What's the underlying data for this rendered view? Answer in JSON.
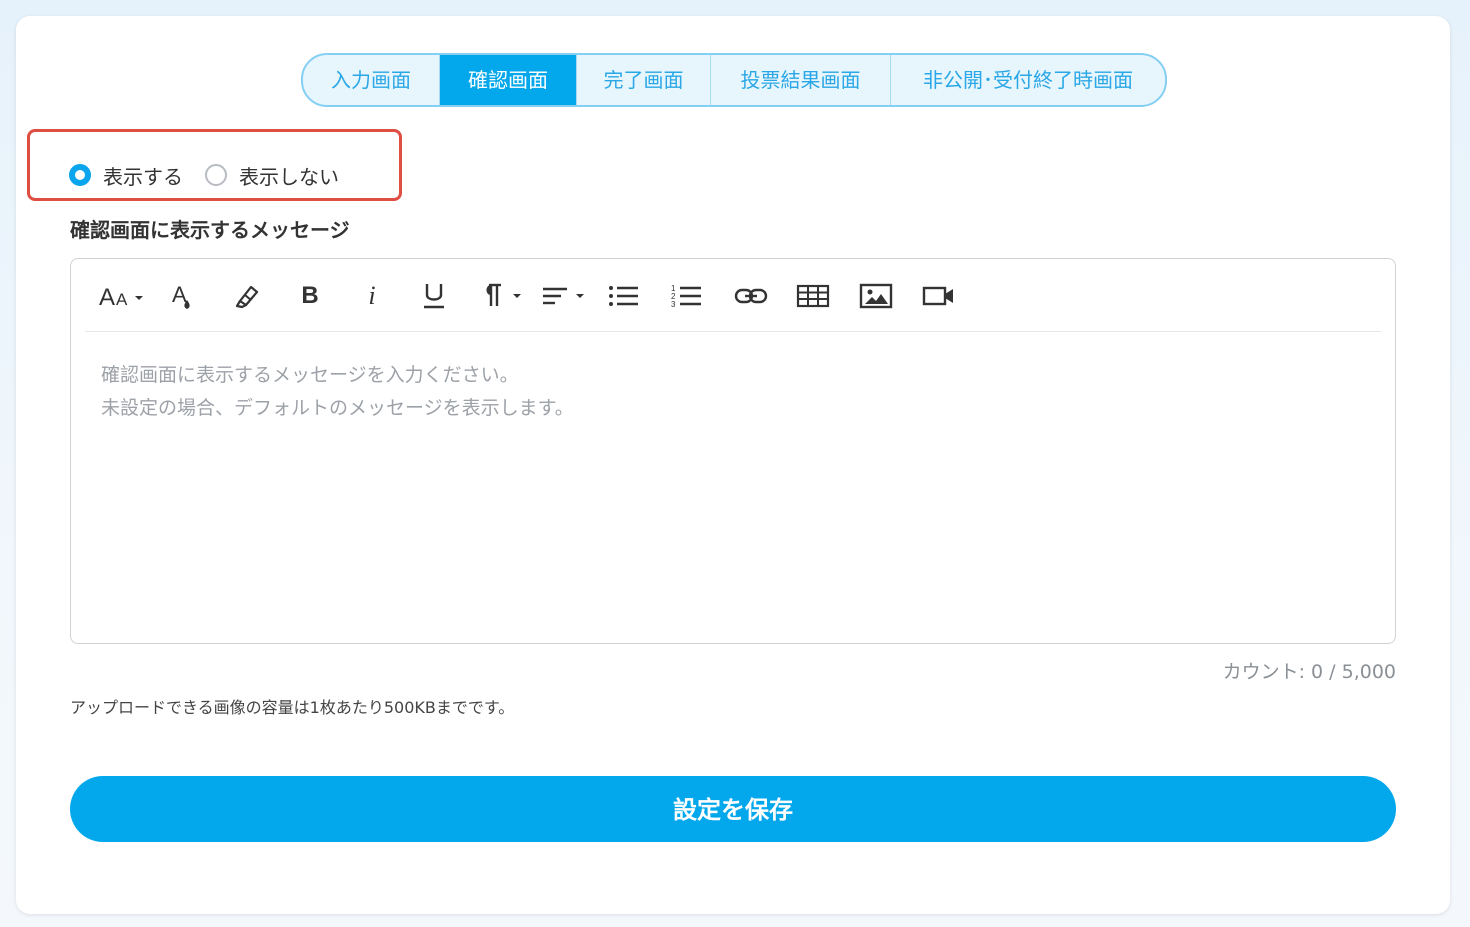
{
  "tabs": [
    {
      "label": "入力画面",
      "active": false
    },
    {
      "label": "確認画面",
      "active": true
    },
    {
      "label": "完了画面",
      "active": false
    },
    {
      "label": "投票結果画面",
      "active": false
    },
    {
      "label": "非公開･受付終了時画面",
      "active": false
    }
  ],
  "display_option": {
    "show_label": "表示する",
    "hide_label": "表示しない",
    "selected": "show"
  },
  "section_label": "確認画面に表示するメッセージ",
  "toolbar": {
    "icons": [
      "font-size-icon",
      "font-color-icon",
      "highlight-icon",
      "bold-icon",
      "italic-icon",
      "underline-icon",
      "paragraph-icon",
      "align-icon",
      "bullet-list-icon",
      "numbered-list-icon",
      "link-icon",
      "table-icon",
      "image-icon",
      "video-icon"
    ],
    "bold": "B",
    "italic": "i"
  },
  "editor": {
    "placeholder": "確認画面に表示するメッセージを入力ください。\n未設定の場合、デフォルトのメッセージを表示します。"
  },
  "counter": "カウント: 0 / 5,000",
  "upload_note": "アップロードできる画像の容量は1枚あたり500KBまでです。",
  "save_label": "設定を保存",
  "colors": {
    "accent": "#03a7eb",
    "highlight_border": "#de4e43",
    "tab_bg": "#e7f5fd"
  }
}
